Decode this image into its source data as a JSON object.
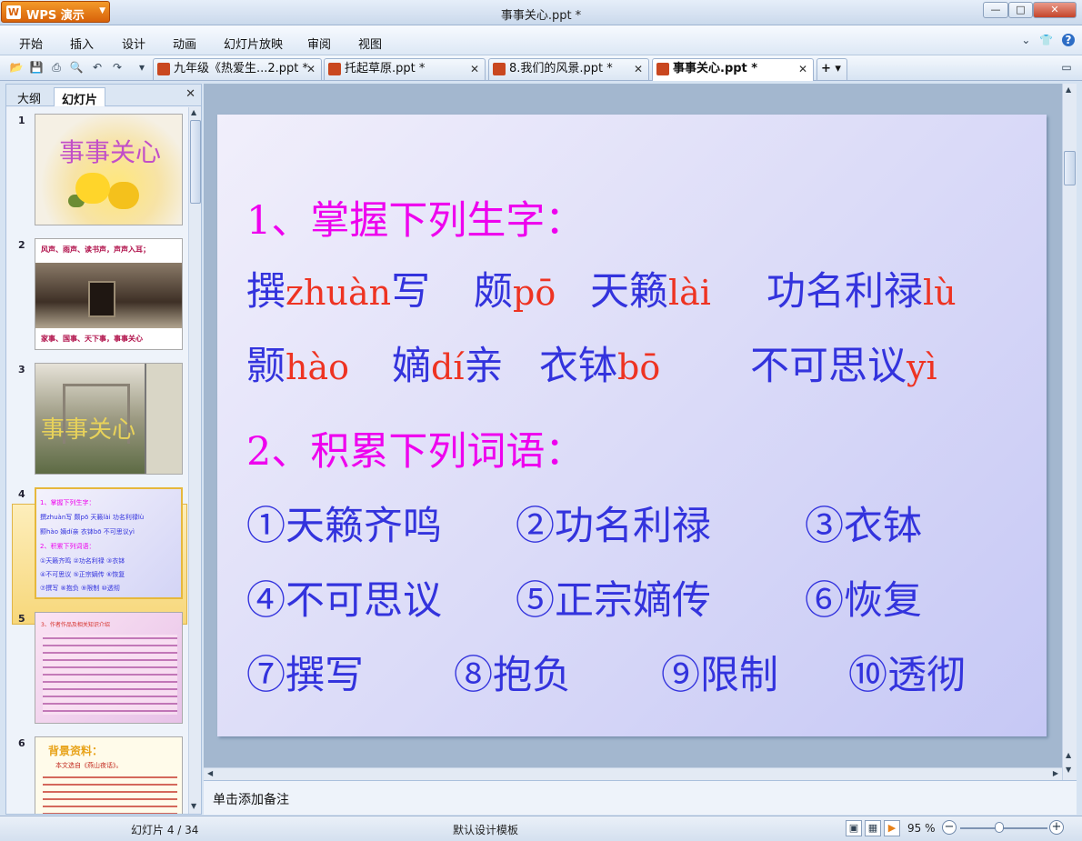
{
  "app": {
    "logo_label": "WPS 演示",
    "window_title": "事事关心.ppt *"
  },
  "window_buttons": {
    "minimize": "—",
    "maximize": "□",
    "close": "✕"
  },
  "menu": [
    "开始",
    "插入",
    "设计",
    "动画",
    "幻灯片放映",
    "审阅",
    "视图"
  ],
  "menu_right": {
    "chevron": "⌄",
    "skin": "👕",
    "help": "?"
  },
  "toolbar_icons": {
    "open": "📂",
    "save": "💾",
    "print": "⎙",
    "preview": "🔍",
    "undo": "↶",
    "redo": "↷",
    "dropdown": "▾"
  },
  "doc_tabs": [
    {
      "label": "九年级《热爱生...2.ppt *",
      "close": "✕"
    },
    {
      "label": "托起草原.ppt *",
      "close": "✕"
    },
    {
      "label": "8.我们的风景.ppt *",
      "close": "✕"
    },
    {
      "label": "事事关心.ppt *",
      "close": "✕"
    }
  ],
  "new_tab": "+ ▾",
  "panel": {
    "tabs": [
      "大纲",
      "幻灯片"
    ],
    "close": "✕",
    "slide_numbers": [
      "1",
      "2",
      "3",
      "4",
      "5",
      "6"
    ],
    "thumb1_title": "事事关心",
    "thumb2_top": "风声、雨声、读书声，声声入耳；",
    "thumb2_bottom": "家事、国事、天下事，事事关心",
    "thumb3_title": "事事关心",
    "thumb4_lines": [
      "1、掌握下列生字：",
      "撰zhuàn写  颇pō  天籁lài  功名利禄lù",
      "颢hào  嫡dí亲  衣钵bō  不可思议yì",
      "2、积累下列词语：",
      "①天籁齐鸣  ②功名利禄  ③衣钵",
      "④不可思议  ⑤正宗嫡传  ⑥恢复",
      "⑦撰写  ⑧抱负  ⑨限制  ⑩透彻"
    ],
    "thumb5_title": "3、作者作品及相关知识介绍",
    "thumb6_title": "背景资料：",
    "thumb6_sub": "本文选自《燕山夜话》。"
  },
  "slide": {
    "heading1": "1、掌握下列生字：",
    "heading2": "2、积累下列词语：",
    "chars": [
      {
        "hz1": "撰",
        "py": "zhuàn",
        "hz2": "写"
      },
      {
        "hz1": "颇",
        "py": "pō",
        "hz2": ""
      },
      {
        "hz1": "天籁",
        "py": "lài",
        "hz2": ""
      },
      {
        "hz1": "功名利禄",
        "py": "lù",
        "hz2": ""
      },
      {
        "hz1": "颢",
        "py": "hào",
        "hz2": ""
      },
      {
        "hz1": "嫡",
        "py": "dí",
        "hz2": "亲"
      },
      {
        "hz1": "衣钵",
        "py": "bō",
        "hz2": ""
      },
      {
        "hz1": "不可思议",
        "py": "yì",
        "hz2": ""
      }
    ],
    "words": [
      "①天籁齐鸣",
      "②功名利禄",
      "③衣钵",
      "④不可思议",
      "⑤正宗嫡传",
      "⑥恢复",
      "⑦撰写",
      "⑧抱负",
      "⑨限制",
      "⑩透彻"
    ]
  },
  "notes_placeholder": "单击添加备注",
  "status": {
    "slide_indicator": "幻灯片 4 / 34",
    "template": "默认设计模板",
    "zoom": "95 %",
    "zoom_fraction": 0.45,
    "zoom_minus": "−",
    "zoom_plus": "+"
  },
  "colors": {
    "heading": "#ee00ee",
    "hanzi": "#3333dd",
    "pinyin": "#ee3322",
    "accent": "#e7821a"
  }
}
